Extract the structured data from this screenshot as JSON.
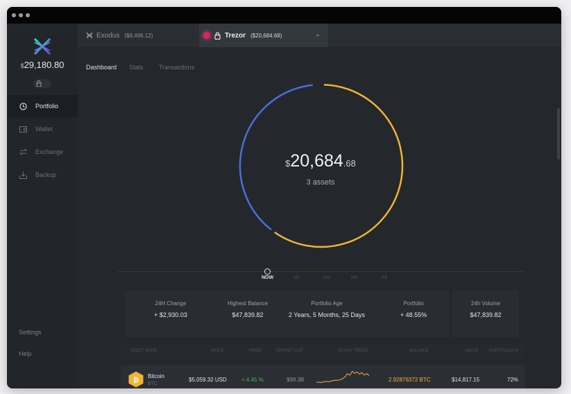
{
  "sidebar": {
    "total_currency": "$",
    "total_amount": "29,180.80",
    "nav": [
      {
        "label": "Portfolio",
        "icon": "clock-icon"
      },
      {
        "label": "Wallet",
        "icon": "wallet-icon"
      },
      {
        "label": "Exchange",
        "icon": "exchange-icon"
      },
      {
        "label": "Backup",
        "icon": "backup-icon"
      }
    ],
    "settings_label": "Settings",
    "help_label": "Help"
  },
  "wallet_tabs": [
    {
      "name": "Exodus",
      "amount": "($8,496.12)"
    },
    {
      "name": "Trezor",
      "amount": "($20,684.68)"
    }
  ],
  "subtabs": [
    "Dashboard",
    "Stats",
    "Transactions"
  ],
  "portfolio": {
    "currency": "$",
    "whole": "20,684",
    "cents": ".68",
    "assets_label": "3 assets"
  },
  "timeline": {
    "labels": [
      "NOW",
      "1D",
      "1W",
      "1M",
      "All"
    ]
  },
  "stats": [
    {
      "label": "24H Change",
      "value": "+ $2,930.03"
    },
    {
      "label": "Highest Balance",
      "value": "$47,839.82"
    },
    {
      "label": "Portfolio Age",
      "value": "2 Years, 5 Months, 25 Days"
    },
    {
      "label": "Portfolio",
      "value": "+ 48.55%"
    },
    {
      "label": "24h Volume",
      "value": "$47,839.82"
    }
  ],
  "asset_columns": [
    "ASSET NAME",
    "PRICE",
    "PRICE",
    "MARKET CAP",
    "30 DAY TREND",
    "BALANCE",
    "VALUE",
    "PORTFOLIO %"
  ],
  "assets": [
    {
      "name": "Bitcoin",
      "ticker": "BTC",
      "price": "$5,059.32 USD",
      "change": "+ 4.45 %",
      "market_cap": "$99.3B",
      "balance": "2.92876372 BTC",
      "value": "$14,817.15",
      "portfolio_pct": "72%",
      "trend": [
        0.3,
        0.31,
        0.29,
        0.33,
        0.35,
        0.34,
        0.36,
        0.4,
        0.42,
        0.41,
        0.45,
        0.5,
        0.62,
        0.78,
        0.7,
        0.92,
        0.8,
        0.88,
        0.75,
        0.84,
        0.7,
        0.78,
        0.68
      ]
    }
  ],
  "colors": {
    "accent_blue": "#4a6fd8",
    "accent_gold": "#f2b530",
    "positive_green": "#4caf50",
    "alert_red": "#d8265a"
  }
}
